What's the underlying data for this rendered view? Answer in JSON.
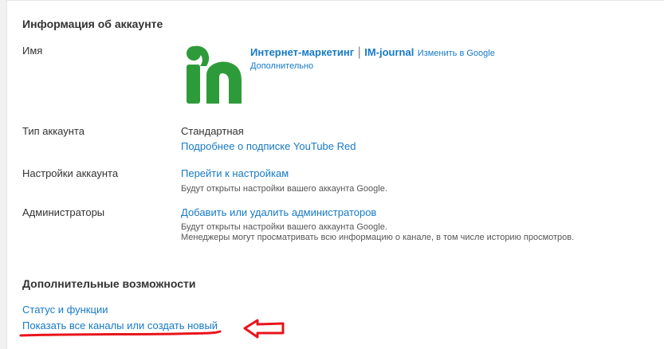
{
  "account_info": {
    "section_title": "Информация об аккаунте",
    "name": {
      "label": "Имя",
      "channel_name": "Интернет-маркетинг",
      "separator": "|",
      "channel_brand": "IM-journal",
      "change_link": "Изменить в Google",
      "more_link": "Дополнительно"
    },
    "account_type": {
      "label": "Тип аккаунта",
      "value": "Стандартная",
      "link": "Подробнее о подписке YouTube Red"
    },
    "account_settings": {
      "label": "Настройки аккаунта",
      "link": "Перейти к настройкам",
      "note": "Будут открыты настройки вашего аккаунта Google."
    },
    "administrators": {
      "label": "Администраторы",
      "link": "Добавить или удалить администраторов",
      "note_line1": "Будут открыты настройки вашего аккаунта Google.",
      "note_line2": "Менеджеры могут просматривать всю информацию о канале, в том числе историю просмотров."
    }
  },
  "additional": {
    "section_title": "Дополнительные возможности",
    "status_link": "Статус и функции",
    "channels_link": "Показать все каналы или создать новый"
  },
  "icons": {
    "logo": "im-journal-logo-icon",
    "arrow": "red-arrow-left-icon"
  },
  "colors": {
    "link": "#167ac6",
    "logo_green": "#2e9b3a",
    "annotation_red": "#e8141b"
  }
}
